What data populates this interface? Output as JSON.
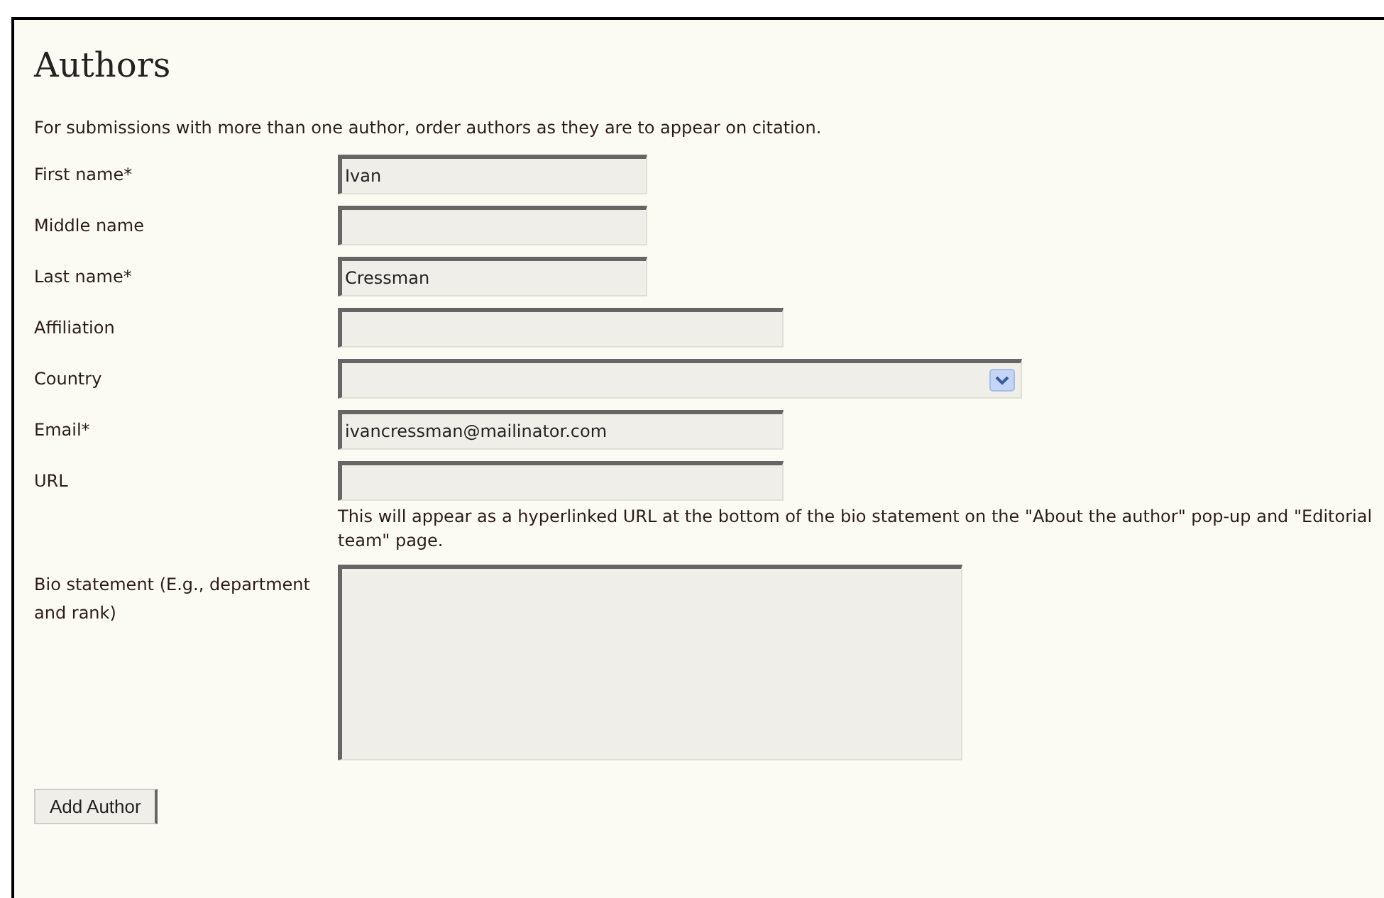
{
  "heading": "Authors",
  "intro": "For submissions with more than one author, order authors as they are to appear on citation.",
  "fields": [
    {
      "label": "First name*",
      "kind": "text",
      "value": "Ivan"
    },
    {
      "label": "Middle name",
      "kind": "text"
    },
    {
      "label": "Last name*",
      "kind": "text",
      "value": "Cressman"
    },
    {
      "label": "Affiliation",
      "kind": "text"
    },
    {
      "label": "Country",
      "kind": "select"
    },
    {
      "label": "Email*",
      "kind": "text",
      "value": "ivancressman@mailinator.com"
    },
    {
      "label": "URL",
      "kind": "text",
      "help": "This will appear as a hyperlinked URL at the bottom of the bio statement on the \"About the author\" pop-up and \"Editorial team\" page."
    },
    {
      "label": "Bio statement (E.g., department and rank)",
      "kind": "textarea"
    }
  ],
  "button": "Add Author"
}
